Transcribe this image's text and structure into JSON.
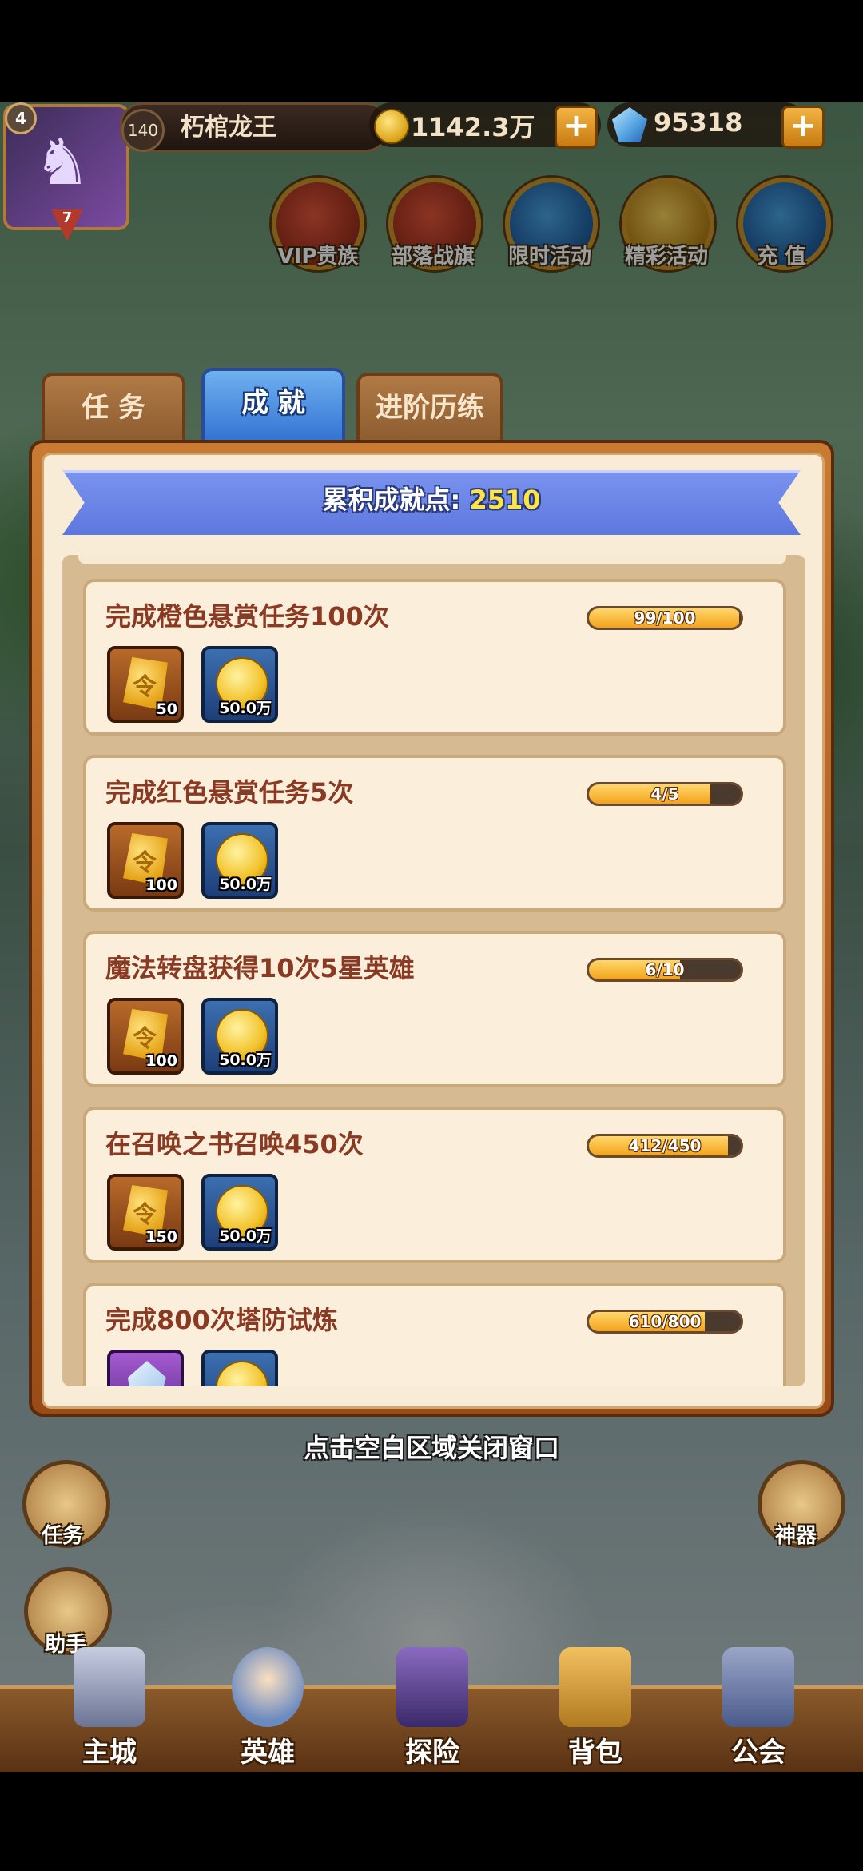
{
  "player": {
    "avatar_level": "4",
    "vip_level": "7",
    "level": "140",
    "name": "朽棺龙王",
    "gold": "1142.3万",
    "gems": "95318"
  },
  "features": [
    {
      "label": "VIP贵族",
      "icon": "crown-icon"
    },
    {
      "label": "部落战旗",
      "icon": "banner-icon"
    },
    {
      "label": "限时活动",
      "icon": "compass-icon"
    },
    {
      "label": "精彩活动",
      "icon": "scroll-icon"
    },
    {
      "label": "充  值",
      "icon": "diamond-icon"
    }
  ],
  "tabs": [
    {
      "label": "任 务",
      "active": false
    },
    {
      "label": "成 就",
      "active": true
    },
    {
      "label": "进阶历练",
      "active": false
    }
  ],
  "achievement_points": {
    "label": "累积成就点: ",
    "value": "2510"
  },
  "achievements": [
    {
      "title": "完成橙色悬赏任务100次",
      "progress_text": "99/100",
      "progress": 0.99,
      "rewards": [
        {
          "icon": "rune-icon",
          "qty": "50"
        },
        {
          "icon": "coin-icon",
          "qty": "50.0万"
        }
      ]
    },
    {
      "title": "完成红色悬赏任务5次",
      "progress_text": "4/5",
      "progress": 0.8,
      "rewards": [
        {
          "icon": "rune-icon",
          "qty": "100"
        },
        {
          "icon": "coin-icon",
          "qty": "50.0万"
        }
      ]
    },
    {
      "title": "魔法转盘获得10次5星英雄",
      "progress_text": "6/10",
      "progress": 0.6,
      "rewards": [
        {
          "icon": "rune-icon",
          "qty": "100"
        },
        {
          "icon": "coin-icon",
          "qty": "50.0万"
        }
      ]
    },
    {
      "title": "在召唤之书召唤450次",
      "progress_text": "412/450",
      "progress": 0.9156,
      "rewards": [
        {
          "icon": "rune-icon",
          "qty": "150"
        },
        {
          "icon": "coin-icon",
          "qty": "50.0万"
        }
      ]
    },
    {
      "title": "完成800次塔防试炼",
      "progress_text": "610/800",
      "progress": 0.7625,
      "rewards": [
        {
          "icon": "crystal-icon",
          "qty": ""
        },
        {
          "icon": "coin-icon",
          "qty": ""
        }
      ]
    }
  ],
  "hint": "点击空白区域关闭窗口",
  "side_buttons": {
    "quest": "任务",
    "artifact": "神器",
    "helper": "助手"
  },
  "nav": [
    "主城",
    "英雄",
    "探险",
    "背包",
    "公会"
  ]
}
